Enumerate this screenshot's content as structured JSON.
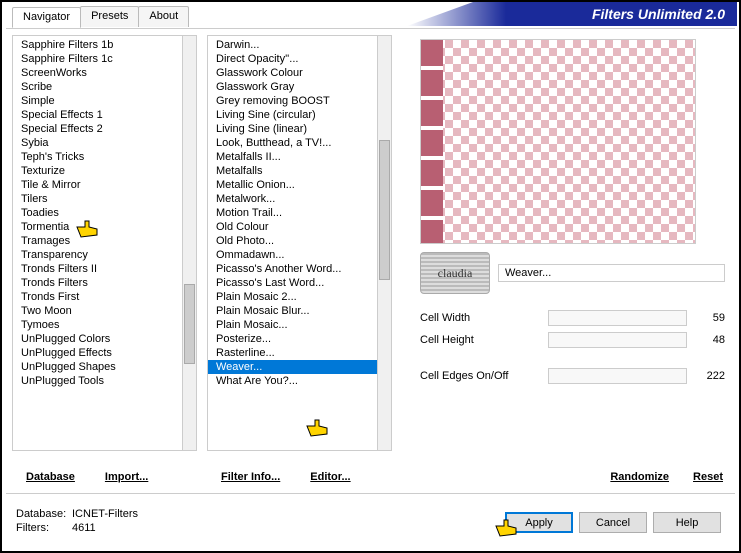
{
  "title": "Filters Unlimited 2.0",
  "tabs": {
    "t0": "Navigator",
    "t1": "Presets",
    "t2": "About"
  },
  "list1": {
    "i0": "Sapphire Filters 1b",
    "i1": "Sapphire Filters 1c",
    "i2": "ScreenWorks",
    "i3": "Scribe",
    "i4": "Simple",
    "i5": "Special Effects 1",
    "i6": "Special Effects 2",
    "i7": "Sybia",
    "i8": "Teph's Tricks",
    "i9": "Texturize",
    "i10": "Tile & Mirror",
    "i11": "Tilers",
    "i12": "Toadies",
    "i13": "Tormentia",
    "i14": "Tramages",
    "i15": "Transparency",
    "i16": "Tronds Filters II",
    "i17": "Tronds Filters",
    "i18": "Tronds First",
    "i19": "Two Moon",
    "i20": "Tymoes",
    "i21": "UnPlugged Colors",
    "i22": "UnPlugged Effects",
    "i23": "UnPlugged Shapes",
    "i24": "UnPlugged Tools"
  },
  "list2": {
    "i0": "Darwin...",
    "i1": "Direct Opacity''...",
    "i2": "Glasswork Colour",
    "i3": "Glasswork Gray",
    "i4": "Grey removing BOOST",
    "i5": "Living Sine (circular)",
    "i6": "Living Sine (linear)",
    "i7": "Look, Butthead, a TV!...",
    "i8": "Metalfalls II...",
    "i9": "Metalfalls",
    "i10": "Metallic Onion...",
    "i11": "Metalwork...",
    "i12": "Motion Trail...",
    "i13": "Old Colour",
    "i14": "Old Photo...",
    "i15": "Ommadawn...",
    "i16": "Picasso's Another Word...",
    "i17": "Picasso's Last Word...",
    "i18": "Plain Mosaic 2...",
    "i19": "Plain Mosaic Blur...",
    "i20": "Plain Mosaic...",
    "i21": "Posterize...",
    "i22": "Rasterline...",
    "i23": "Weaver...",
    "i24": "What Are You?..."
  },
  "links": {
    "database": "Database",
    "import": "Import...",
    "filterinfo": "Filter Info...",
    "editor": "Editor...",
    "randomize": "Randomize",
    "reset": "Reset"
  },
  "filter_name": "Weaver...",
  "sliders": {
    "s0": {
      "label": "Cell Width",
      "value": "59"
    },
    "s1": {
      "label": "Cell Height",
      "value": "48"
    },
    "s2": {
      "label": "Cell Edges On/Off",
      "value": "222"
    }
  },
  "footer": {
    "db_label": "Database:",
    "db_value": "ICNET-Filters",
    "flt_label": "Filters:",
    "flt_value": "4611",
    "apply": "Apply",
    "cancel": "Cancel",
    "help": "Help"
  },
  "badge": "claudia"
}
